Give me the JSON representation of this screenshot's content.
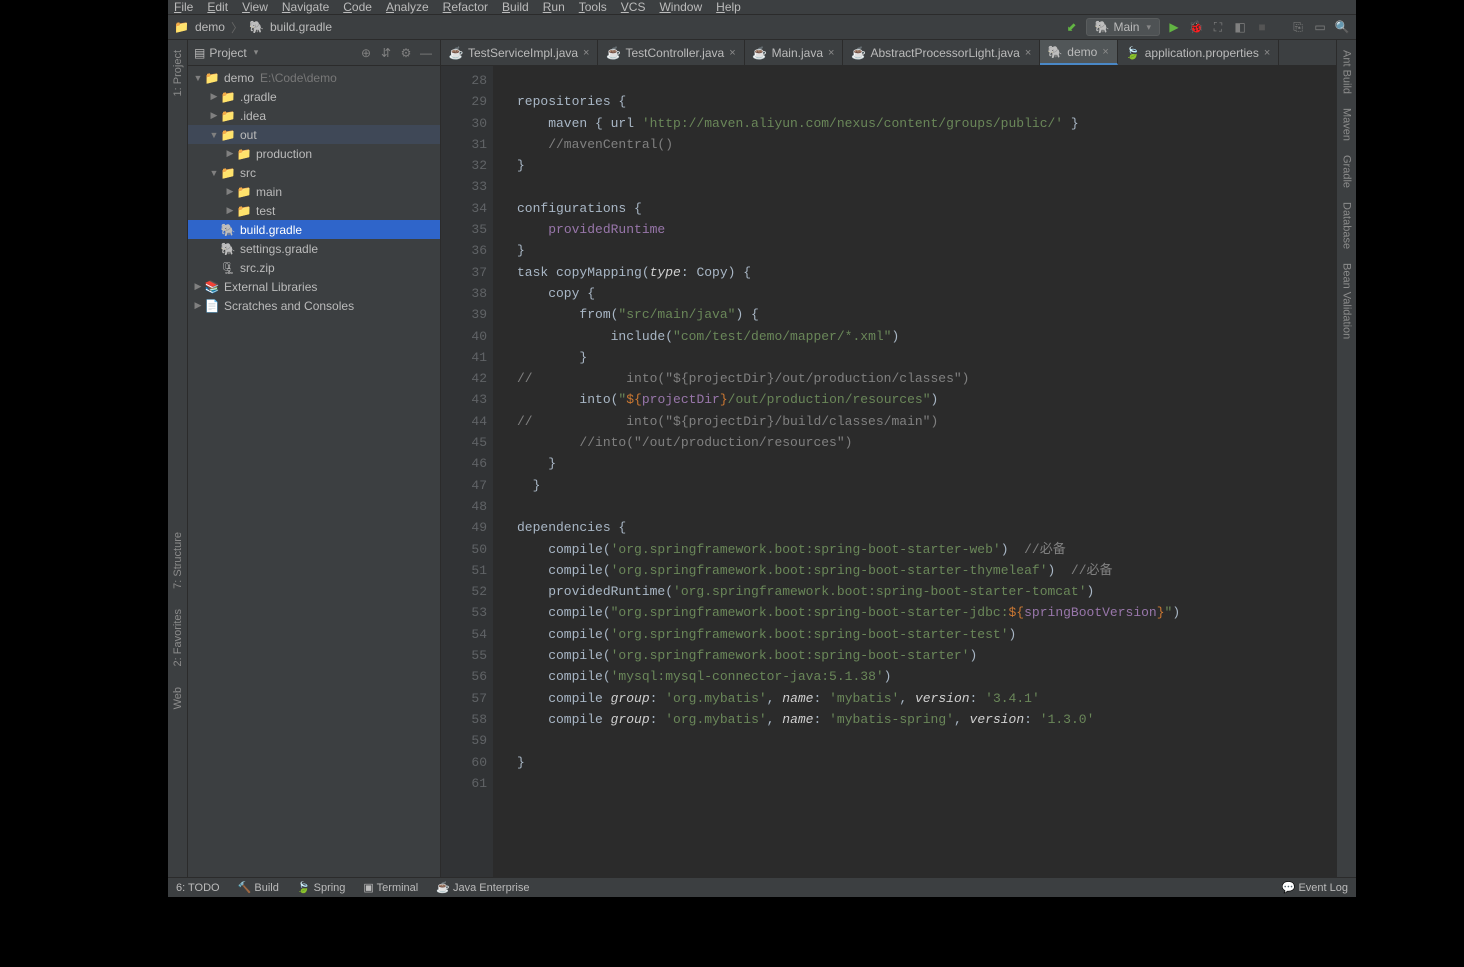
{
  "menu": [
    "File",
    "Edit",
    "View",
    "Navigate",
    "Code",
    "Analyze",
    "Refactor",
    "Build",
    "Run",
    "Tools",
    "VCS",
    "Window",
    "Help"
  ],
  "breadcrumb": {
    "project": "demo",
    "file": "build.gradle"
  },
  "runConfig": "Main",
  "projectPanel": {
    "title": "Project"
  },
  "tree": {
    "root": {
      "name": "demo",
      "path": "E:\\Code\\demo"
    },
    "items": [
      {
        "indent": 1,
        "name": ".gradle",
        "type": "folder",
        "arrow": "▶"
      },
      {
        "indent": 1,
        "name": ".idea",
        "type": "folder",
        "arrow": "▶"
      },
      {
        "indent": 1,
        "name": "out",
        "type": "folder",
        "arrow": "▼",
        "hovered": true
      },
      {
        "indent": 2,
        "name": "production",
        "type": "folder",
        "arrow": "▶"
      },
      {
        "indent": 1,
        "name": "src",
        "type": "folder",
        "arrow": "▼"
      },
      {
        "indent": 2,
        "name": "main",
        "type": "folder",
        "arrow": "▶"
      },
      {
        "indent": 2,
        "name": "test",
        "type": "folder",
        "arrow": "▶"
      },
      {
        "indent": 1,
        "name": "build.gradle",
        "type": "gradle",
        "selected": true
      },
      {
        "indent": 1,
        "name": "settings.gradle",
        "type": "gradle"
      },
      {
        "indent": 1,
        "name": "src.zip",
        "type": "zip"
      }
    ],
    "extra": [
      {
        "name": "External Libraries",
        "icon": "lib"
      },
      {
        "name": "Scratches and Consoles",
        "icon": "scratch"
      }
    ]
  },
  "tabs": [
    {
      "name": "TestServiceImpl.java",
      "icon": "java"
    },
    {
      "name": "TestController.java",
      "icon": "java"
    },
    {
      "name": "Main.java",
      "icon": "java"
    },
    {
      "name": "AbstractProcessorLight.java",
      "icon": "java"
    },
    {
      "name": "demo",
      "icon": "gradle",
      "active": true
    },
    {
      "name": "application.properties",
      "icon": "props"
    }
  ],
  "code": {
    "startLine": 28,
    "lines": [
      {
        "n": 28,
        "t": ""
      },
      {
        "n": 29,
        "t": "repositories {"
      },
      {
        "n": 30,
        "t": "    maven { url 'http://maven.aliyun.com/nexus/content/groups/public/' }",
        "s": true
      },
      {
        "n": 31,
        "t": "    //mavenCentral()",
        "c": true
      },
      {
        "n": 32,
        "t": "}"
      },
      {
        "n": 33,
        "t": ""
      },
      {
        "n": 34,
        "t": "configurations {"
      },
      {
        "n": 35,
        "t": "    providedRuntime",
        "nm": true
      },
      {
        "n": 36,
        "t": "}"
      },
      {
        "n": 37,
        "t": "task copyMapping(type: Copy) {",
        "run": true,
        "ty": true
      },
      {
        "n": 38,
        "t": "    copy {"
      },
      {
        "n": 39,
        "t": "        from(\"src/main/java\") {",
        "s": true
      },
      {
        "n": 40,
        "t": "            include(\"com/test/demo/mapper/*.xml\")",
        "s": true
      },
      {
        "n": 41,
        "t": "        }"
      },
      {
        "n": 42,
        "t": "//            into(\"${projectDir}/out/production/classes\")",
        "c": true
      },
      {
        "n": 43,
        "t": "        into(\"${projectDir}/out/production/resources\")",
        "s2": true
      },
      {
        "n": 44,
        "t": "//            into(\"${projectDir}/build/classes/main\")",
        "c": true
      },
      {
        "n": 45,
        "t": "        //into(\"/out/production/resources\")",
        "c": true
      },
      {
        "n": 46,
        "t": "    }"
      },
      {
        "n": 47,
        "t": "  }"
      },
      {
        "n": 48,
        "t": ""
      },
      {
        "n": 49,
        "t": "dependencies {",
        "run": true
      },
      {
        "n": 50,
        "t": "    compile('org.springframework.boot:spring-boot-starter-web')  //必备",
        "dep": true
      },
      {
        "n": 51,
        "t": "    compile('org.springframework.boot:spring-boot-starter-thymeleaf')  //必备",
        "dep": true
      },
      {
        "n": 52,
        "t": "    providedRuntime('org.springframework.boot:spring-boot-starter-tomcat')",
        "dep": true
      },
      {
        "n": 53,
        "t": "    compile(\"org.springframework.boot:spring-boot-starter-jdbc:${springBootVersion}\")",
        "dep2": true
      },
      {
        "n": 54,
        "t": "    compile('org.springframework.boot:spring-boot-starter-test')",
        "dep": true
      },
      {
        "n": 55,
        "t": "    compile('org.springframework.boot:spring-boot-starter')",
        "dep": true
      },
      {
        "n": 56,
        "t": "    compile('mysql:mysql-connector-java:5.1.38')",
        "dep": true
      },
      {
        "n": 57,
        "t": "    compile group: 'org.mybatis', name: 'mybatis', version: '3.4.1'",
        "kv": true
      },
      {
        "n": 58,
        "t": "    compile group: 'org.mybatis', name: 'mybatis-spring', version: '1.3.0'",
        "kv": true
      },
      {
        "n": 59,
        "t": ""
      },
      {
        "n": 60,
        "t": "}"
      },
      {
        "n": 61,
        "t": ""
      }
    ]
  },
  "leftTabs": [
    "1: Project",
    "7: Structure",
    "2: Favorites",
    "Web"
  ],
  "rightTabs": [
    "Ant Build",
    "Maven",
    "Gradle",
    "Database",
    "Bean Validation"
  ],
  "statusBar": {
    "todo": "6: TODO",
    "build": "Build",
    "spring": "Spring",
    "terminal": "Terminal",
    "javaee": "Java Enterprise",
    "eventlog": "Event Log"
  }
}
